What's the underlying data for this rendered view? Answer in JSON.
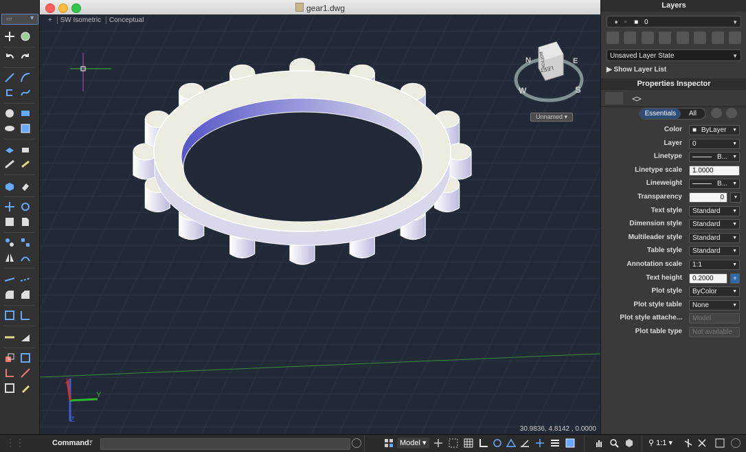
{
  "window": {
    "title": "gear1.dwg"
  },
  "viewport": {
    "controls": [
      "+",
      "SW Isometric",
      "Conceptual"
    ],
    "viewcube": {
      "faces": [
        "LEFT",
        "BOTTOM"
      ],
      "compass": [
        "N",
        "E",
        "S",
        "W"
      ],
      "ucs_menu": "Unnamed"
    },
    "coordinates": "30.9836, 4.8142 , 0.0000",
    "ucs_axes": [
      "X",
      "Y",
      "Z"
    ]
  },
  "layers_panel": {
    "title": "Layers",
    "current_layer": "0",
    "layer_state": "Unsaved Layer State",
    "show_list_label": "Show Layer List"
  },
  "properties_inspector": {
    "title": "Properties Inspector",
    "tabs": [
      "Essentials",
      "All"
    ],
    "rows": [
      {
        "label": "Color",
        "value": "ByLayer",
        "kind": "dropdown"
      },
      {
        "label": "Layer",
        "value": "0",
        "kind": "dropdown"
      },
      {
        "label": "Linetype",
        "value": "B...",
        "kind": "dropdown"
      },
      {
        "label": "Linetype scale",
        "value": "1.0000",
        "kind": "input"
      },
      {
        "label": "Lineweight",
        "value": "B...",
        "kind": "dropdown"
      },
      {
        "label": "Transparency",
        "value": "0",
        "kind": "input"
      },
      {
        "label": "Text style",
        "value": "Standard",
        "kind": "dropdown"
      },
      {
        "label": "Dimension style",
        "value": "Standard",
        "kind": "dropdown"
      },
      {
        "label": "Multileader style",
        "value": "Standard",
        "kind": "dropdown"
      },
      {
        "label": "Table style",
        "value": "Standard",
        "kind": "dropdown"
      },
      {
        "label": "Annotation scale",
        "value": "1:1",
        "kind": "dropdown"
      },
      {
        "label": "Text height",
        "value": "0.2000",
        "kind": "input"
      },
      {
        "label": "Plot style",
        "value": "ByColor",
        "kind": "dropdown"
      },
      {
        "label": "Plot style table",
        "value": "None",
        "kind": "dropdown"
      },
      {
        "label": "Plot style attache...",
        "value": "Model",
        "kind": "disabled"
      },
      {
        "label": "Plot table type",
        "value": "Not available",
        "kind": "disabled"
      }
    ]
  },
  "statusbar": {
    "command_label": "Command:",
    "layout": "Model",
    "annotation_scale": "1:1"
  },
  "colors": {
    "viewport_bg": "#222a38",
    "gear_face": "#ecece0",
    "gear_inner": "#6a6ad0",
    "accent": "#5c84c8"
  }
}
